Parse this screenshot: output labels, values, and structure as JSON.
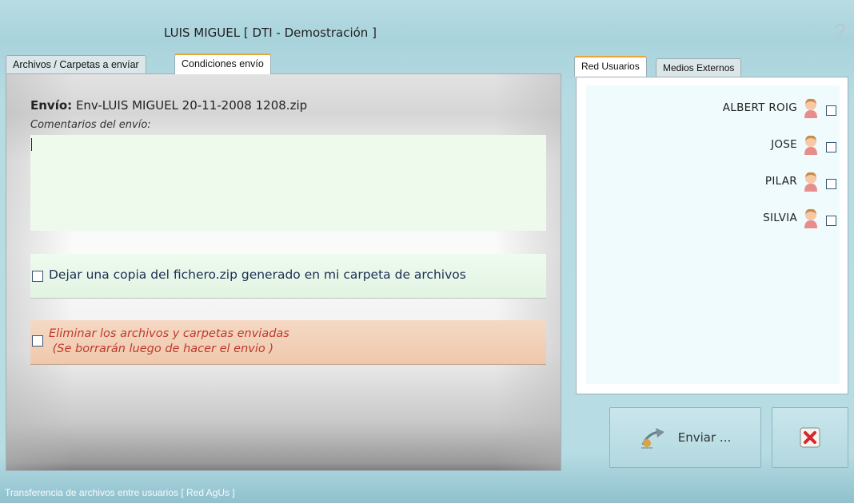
{
  "window": {
    "title": "LUIS MIGUEL  [ DTI - Demostración ]",
    "help_symbol": "?"
  },
  "left_tabs": [
    {
      "label": "Archivos / Carpetas a envíar",
      "active": false
    },
    {
      "label": "Condiciones envío",
      "active": true
    }
  ],
  "conditions": {
    "envio_label": "Envío:",
    "envio_value": "Env-LUIS MIGUEL 20-11-2008 1208.zip",
    "comment_label": "Comentarios del envío:",
    "comment_value": "",
    "copy_option": {
      "label": "Dejar una copia del fichero.zip generado en mi carpeta de archivos",
      "checked": false
    },
    "delete_option": {
      "label": "Eliminar los archivos y carpetas enviadas\n (Se borrarán luego de hacer el envio )",
      "checked": false
    }
  },
  "right_tabs": [
    {
      "label": "Red Usuarios",
      "active": true
    },
    {
      "label": "Medios Externos",
      "active": false
    }
  ],
  "users": [
    {
      "name": "ALBERT ROIG",
      "icon": "user-icon",
      "checked": false
    },
    {
      "name": "JOSE",
      "icon": "user-icon",
      "checked": false
    },
    {
      "name": "PILAR",
      "icon": "user-icon",
      "checked": false
    },
    {
      "name": "SILVIA",
      "icon": "user-icon",
      "checked": false
    }
  ],
  "actions": {
    "send_label": "Enviar ...",
    "send_icon": "send-icon",
    "close_icon": "close-icon"
  },
  "status_bar": {
    "text": "Transferencia de archivos entre usuarios [  Red AgUs ]"
  },
  "colors": {
    "window_bg": "#b7dce4",
    "active_tab_accent": "#e7a53a",
    "comment_bg": "#eefbec",
    "copy_option_bg": "#e8f7e8",
    "delete_option_bg": "#f2cfb6",
    "delete_text": "#c0392b",
    "users_list_bg": "#effbfc",
    "close_icon_red": "#d62828"
  }
}
